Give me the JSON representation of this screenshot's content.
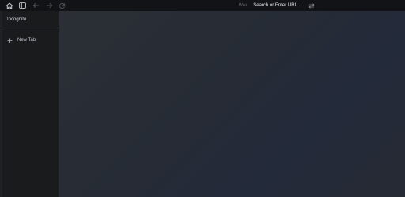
{
  "toolbar": {
    "home_icon": "home-icon",
    "sidebar_toggle_icon": "sidebar-toggle-icon",
    "back_icon": "arrow-left-icon",
    "forward_icon": "arrow-right-icon",
    "reload_icon": "reload-icon",
    "address_prefix": "Wiki",
    "address_placeholder": "Search or Enter URL...",
    "address_action_icon": "swap-icon"
  },
  "sidebar": {
    "title": "Incognito",
    "new_tab_label": "New Tab",
    "new_tab_icon": "plus-icon"
  },
  "colors": {
    "toolbar_bg": "#121317",
    "sidebar_bg": "#1a1b1d",
    "content_bg": "#262b35",
    "text": "#cfd3da"
  }
}
